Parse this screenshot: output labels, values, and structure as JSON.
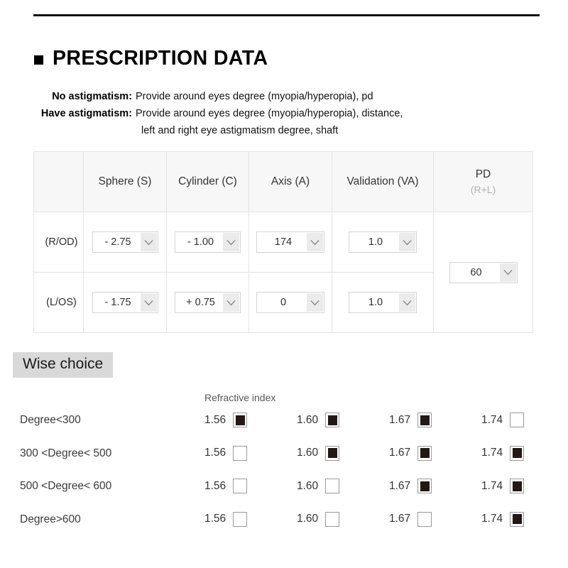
{
  "section": {
    "title": "PRESCRIPTION DATA",
    "bullet_icon": "black-square-bullet-icon"
  },
  "notes": [
    {
      "label": "No astigmatism:",
      "value": "Provide around eyes degree (myopia/hyperopia), pd",
      "continuation": ""
    },
    {
      "label": "Have astigmatism:",
      "value": "Provide around eyes degree (myopia/hyperopia), distance,",
      "continuation": "left and right eye astigmatism degree, shaft"
    }
  ],
  "rx_table": {
    "headers": {
      "corner": "",
      "sphere": "Sphere (S)",
      "cylinder": "Cylinder (C)",
      "axis": "Axis (A)",
      "validation": "Validation (VA)",
      "pd_main": "PD",
      "pd_sub": "(R+L)"
    },
    "rows": [
      {
        "eye_label": "(R/OD)",
        "sphere": "- 2.75",
        "cylinder": "- 1.00",
        "axis": "174",
        "validation": "1.0"
      },
      {
        "eye_label": "(L/OS)",
        "sphere": "- 1.75",
        "cylinder": "+ 0.75",
        "axis": "0",
        "validation": "1.0"
      }
    ],
    "pd_value": "60",
    "dropdown_icon": "chevron-down-icon"
  },
  "wise_choice": {
    "heading": "Wise choice",
    "refractive_index_label": "Refractive index",
    "index_values": [
      "1.56",
      "1.60",
      "1.67",
      "1.74"
    ],
    "rows": [
      {
        "label": "Degree<300",
        "checked": [
          true,
          true,
          true,
          false
        ]
      },
      {
        "label": "300 <Degree< 500",
        "checked": [
          false,
          true,
          true,
          true
        ]
      },
      {
        "label": "500 <Degree< 600",
        "checked": [
          false,
          false,
          true,
          true
        ]
      },
      {
        "label": "Degree>600",
        "checked": [
          false,
          false,
          false,
          true
        ]
      }
    ]
  },
  "colors": {
    "rule": "#111111",
    "header_bg": "#f7f7f7",
    "wise_choice_bg": "#d9d9d9",
    "checkbox_fill": "#231815",
    "select_border": "#d4d4d4",
    "table_border": "#e3e3e3"
  }
}
